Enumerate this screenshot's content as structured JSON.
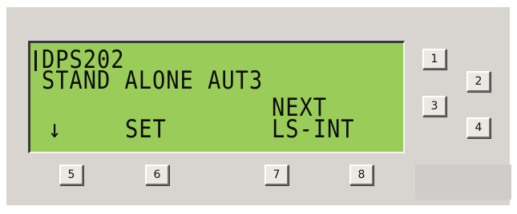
{
  "display": {
    "line1": "DPS202",
    "line2": "STAND ALONE AUT3",
    "line3": "NEXT",
    "line4_left": "↓",
    "line4_mid": "SET",
    "line4_right": "LS-INT"
  },
  "side_keys": [
    "1",
    "2",
    "3",
    "4"
  ],
  "bottom_keys": [
    "5",
    "6",
    "7",
    "8"
  ],
  "colors": {
    "lcd_background": "#9acc5a",
    "panel_background": "#d8d5d0"
  }
}
